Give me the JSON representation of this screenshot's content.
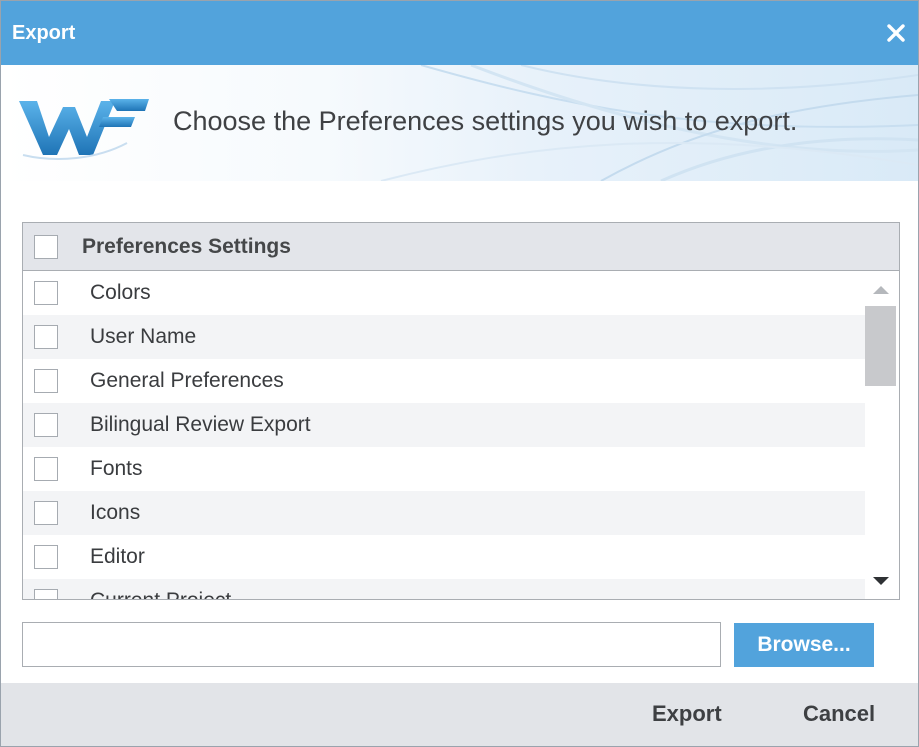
{
  "dialog": {
    "title": "Export",
    "close_icon": "close-icon"
  },
  "banner": {
    "logo": "wf-logo",
    "instruction": "Choose the Preferences settings you wish to export."
  },
  "list": {
    "header_label": "Preferences Settings",
    "items": [
      {
        "label": "Colors",
        "checked": false
      },
      {
        "label": "User Name",
        "checked": false
      },
      {
        "label": "General Preferences",
        "checked": false
      },
      {
        "label": "Bilingual Review Export",
        "checked": false
      },
      {
        "label": "Fonts",
        "checked": false
      },
      {
        "label": "Icons",
        "checked": false
      },
      {
        "label": "Editor",
        "checked": false
      },
      {
        "label": "Current Project",
        "checked": false
      }
    ]
  },
  "file": {
    "value": "",
    "browse_label": "Browse..."
  },
  "footer": {
    "export_label": "Export",
    "cancel_label": "Cancel"
  },
  "colors": {
    "accent": "#52a3dc",
    "footer_bg": "#e2e4e8",
    "header_bg": "#e3e5ea"
  }
}
